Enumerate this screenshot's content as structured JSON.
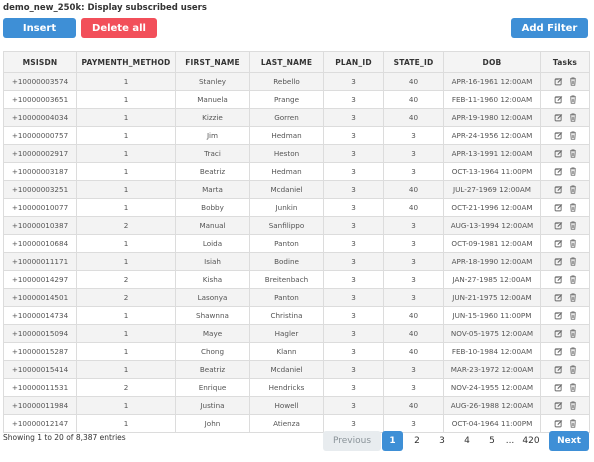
{
  "page": {
    "title": "demo_new_250k: Display subscribed users"
  },
  "toolbar": {
    "insert_label": "Insert",
    "delete_all_label": "Delete all",
    "add_filter_label": "Add Filter"
  },
  "colors": {
    "primary": "#3e8fd6",
    "danger": "#f24f5a",
    "row_stripe": "#f3f3f3",
    "header_bg": "#f4f4f4"
  },
  "table": {
    "columns": [
      "MSISDN",
      "PAYMENTH_METHOD",
      "FIRST_NAME",
      "LAST_NAME",
      "PLAN_ID",
      "STATE_ID",
      "DOB",
      "Tasks"
    ],
    "task_icons": [
      "edit-icon",
      "trash-icon"
    ],
    "rows": [
      [
        "+10000003574",
        "1",
        "Stanley",
        "Rebello",
        "3",
        "40",
        "APR-16-1961 12:00AM"
      ],
      [
        "+10000003651",
        "1",
        "Manuela",
        "Prange",
        "3",
        "40",
        "FEB-11-1960 12:00AM"
      ],
      [
        "+10000004034",
        "1",
        "Kizzie",
        "Gorren",
        "3",
        "40",
        "APR-19-1980 12:00AM"
      ],
      [
        "+10000000757",
        "1",
        "Jim",
        "Hedman",
        "3",
        "3",
        "APR-24-1956 12:00AM"
      ],
      [
        "+10000002917",
        "1",
        "Traci",
        "Heston",
        "3",
        "3",
        "APR-13-1991 12:00AM"
      ],
      [
        "+10000003187",
        "1",
        "Beatriz",
        "Hedman",
        "3",
        "3",
        "OCT-13-1964 11:00PM"
      ],
      [
        "+10000003251",
        "1",
        "Marta",
        "Mcdaniel",
        "3",
        "40",
        "JUL-27-1969 12:00AM"
      ],
      [
        "+10000010077",
        "1",
        "Bobby",
        "Junkin",
        "3",
        "40",
        "OCT-21-1996 12:00AM"
      ],
      [
        "+10000010387",
        "2",
        "Manual",
        "Sanfilippo",
        "3",
        "3",
        "AUG-13-1994 12:00AM"
      ],
      [
        "+10000010684",
        "1",
        "Loida",
        "Panton",
        "3",
        "3",
        "OCT-09-1981 12:00AM"
      ],
      [
        "+10000011171",
        "1",
        "Isiah",
        "Bodine",
        "3",
        "3",
        "APR-18-1990 12:00AM"
      ],
      [
        "+10000014297",
        "2",
        "Kisha",
        "Breitenbach",
        "3",
        "3",
        "JAN-27-1985 12:00AM"
      ],
      [
        "+10000014501",
        "2",
        "Lasonya",
        "Panton",
        "3",
        "3",
        "JUN-21-1975 12:00AM"
      ],
      [
        "+10000014734",
        "1",
        "Shawnna",
        "Christina",
        "3",
        "40",
        "JUN-15-1960 11:00PM"
      ],
      [
        "+10000015094",
        "1",
        "Maye",
        "Hagler",
        "3",
        "40",
        "NOV-05-1975 12:00AM"
      ],
      [
        "+10000015287",
        "1",
        "Chong",
        "Klann",
        "3",
        "40",
        "FEB-10-1984 12:00AM"
      ],
      [
        "+10000015414",
        "1",
        "Beatriz",
        "Mcdaniel",
        "3",
        "3",
        "MAR-23-1972 12:00AM"
      ],
      [
        "+10000011531",
        "2",
        "Enrique",
        "Hendricks",
        "3",
        "3",
        "NOV-24-1955 12:00AM"
      ],
      [
        "+10000011984",
        "1",
        "Justina",
        "Howell",
        "3",
        "40",
        "AUG-26-1988 12:00AM"
      ],
      [
        "+10000012147",
        "1",
        "John",
        "Atienza",
        "3",
        "3",
        "OCT-04-1964 11:00PM"
      ]
    ]
  },
  "footer": {
    "entries_info": "Showing 1 to 20 of 8,387 entries"
  },
  "pagination": {
    "previous_label": "Previous",
    "next_label": "Next",
    "pages": [
      "1",
      "2",
      "3",
      "4",
      "5"
    ],
    "ellipsis": "...",
    "last_page": "420",
    "current_page": "1"
  }
}
